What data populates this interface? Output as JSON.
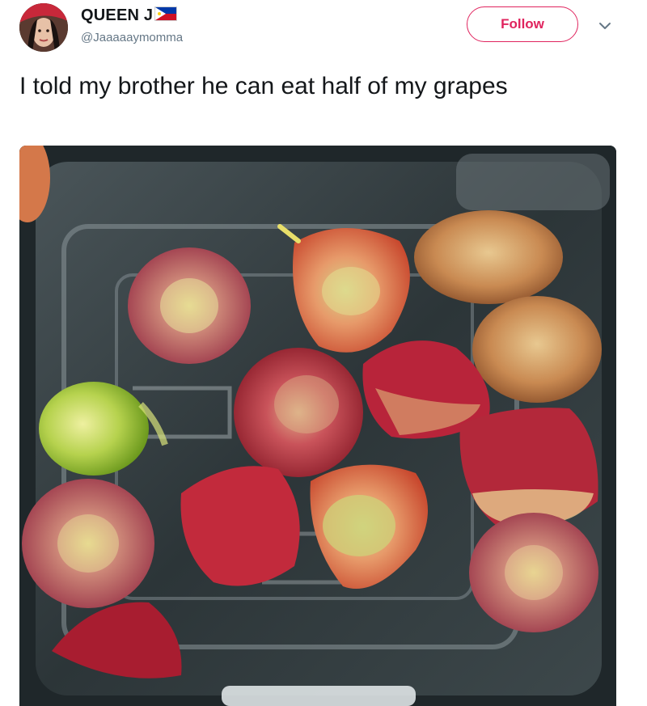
{
  "tweet": {
    "display_name": "QUEEN J",
    "handle": "@Jaaaaaymomma",
    "follow_label": "Follow",
    "text": "I told my brother he can eat half of my grapes"
  },
  "icons": {
    "flag": "philippines-flag-icon",
    "menu": "chevron-down-icon"
  },
  "colors": {
    "follow_accent": "#e0245e",
    "handle_gray": "#657786",
    "text": "#14171a"
  }
}
